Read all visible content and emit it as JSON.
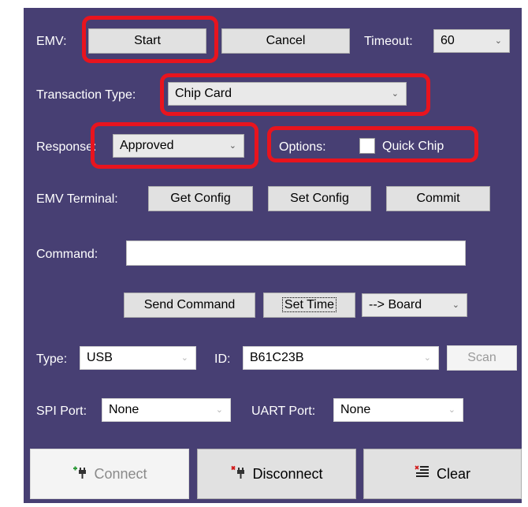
{
  "emv": {
    "label": "EMV:",
    "start_label": "Start",
    "cancel_label": "Cancel",
    "timeout_label": "Timeout:",
    "timeout_value": "60"
  },
  "transaction": {
    "label": "Transaction Type:",
    "value": "Chip Card"
  },
  "response": {
    "label": "Response:",
    "value": "Approved"
  },
  "options": {
    "label": "Options:",
    "quick_chip_label": "Quick Chip",
    "quick_chip_checked": false
  },
  "terminal": {
    "label": "EMV Terminal:",
    "get_config": "Get Config",
    "set_config": "Set Config",
    "commit": "Commit"
  },
  "command": {
    "label": "Command:",
    "value": "",
    "send_label": "Send Command",
    "set_time_label": "Set Time",
    "target_value": "--> Board"
  },
  "connection": {
    "type_label": "Type:",
    "type_value": "USB",
    "id_label": "ID:",
    "id_value": "B61C23B",
    "scan_label": "Scan",
    "spi_label": "SPI Port:",
    "spi_value": "None",
    "uart_label": "UART Port:",
    "uart_value": "None"
  },
  "actions": {
    "connect_label": "Connect",
    "disconnect_label": "Disconnect",
    "clear_label": "Clear"
  },
  "colors": {
    "panel_background": "#473f73",
    "highlight_red": "#e8141e"
  }
}
